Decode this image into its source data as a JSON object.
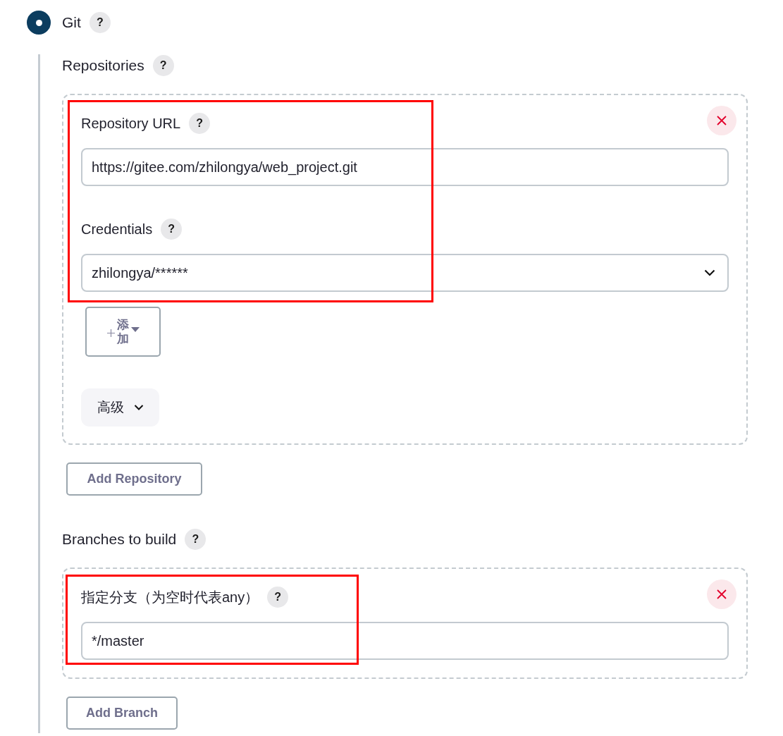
{
  "scm": {
    "label": "Git",
    "selected": true,
    "help": "?"
  },
  "repositories": {
    "label": "Repositories",
    "help": "?",
    "items": [
      {
        "highlighted": true,
        "fields": [
          {
            "kind": "text",
            "label": "Repository URL",
            "help": "?",
            "value": "https://gitee.com/zhilongya/web_project.git"
          },
          {
            "kind": "select",
            "label": "Credentials",
            "help": "?",
            "value": "zhilongya/******",
            "add_button": "添加"
          }
        ],
        "advanced_button": "高级"
      }
    ],
    "add_button": "Add Repository"
  },
  "branches": {
    "label": "Branches to build",
    "help": "?",
    "items": [
      {
        "highlighted": true,
        "fields": [
          {
            "kind": "text",
            "label": "指定分支（为空时代表any）",
            "help": "?",
            "value": "*/master"
          }
        ]
      }
    ],
    "add_button": "Add Branch"
  }
}
